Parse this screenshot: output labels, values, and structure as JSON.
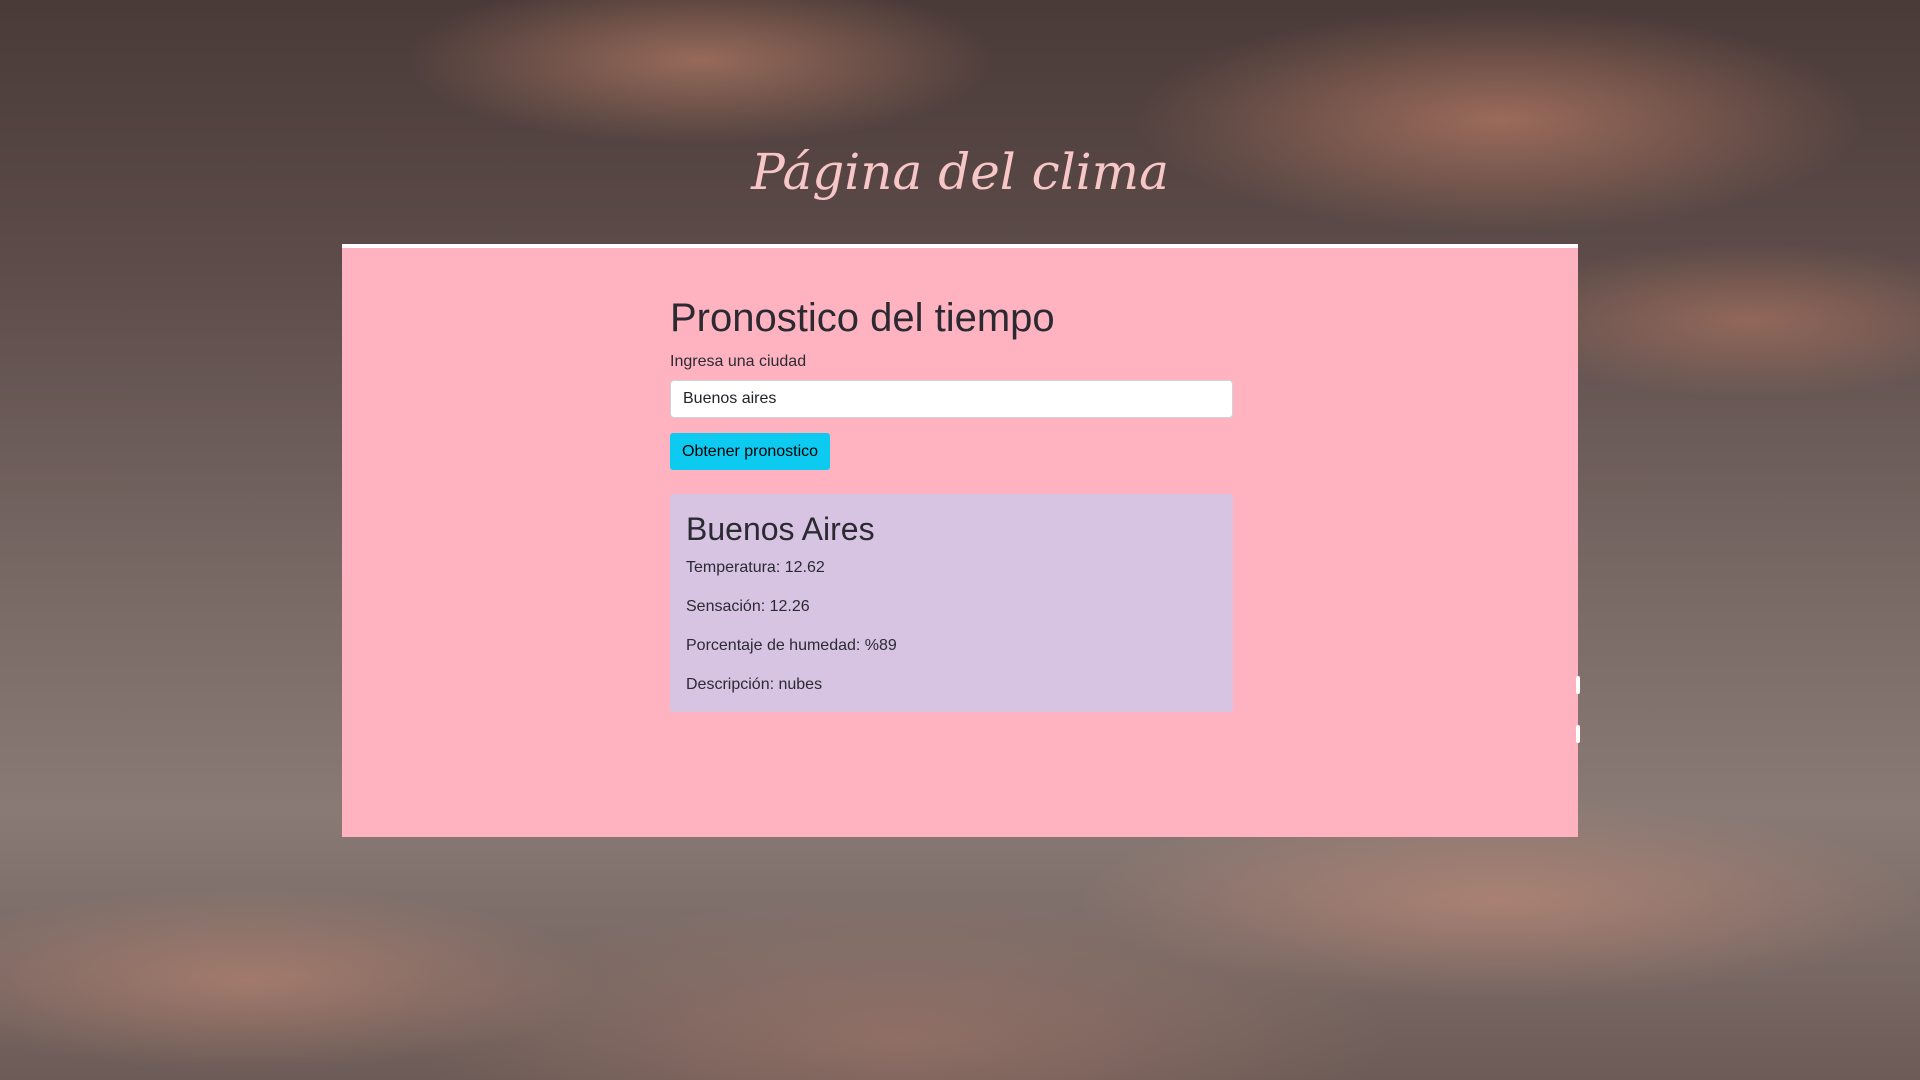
{
  "page": {
    "title": "Página del clima"
  },
  "form": {
    "heading": "Pronostico del tiempo",
    "label": "Ingresa una ciudad",
    "input_value": "Buenos aires",
    "button_label": "Obtener pronostico"
  },
  "result": {
    "city": "Buenos Aires",
    "temperature": "Temperatura: 12.62",
    "feels_like": "Sensación: 12.26",
    "humidity": "Porcentaje de humedad: %89",
    "description": "Descripción: nubes"
  },
  "colors": {
    "panel": "#ffb3c1",
    "card": "#d7c3e2",
    "button": "#0dcaf0",
    "title": "#f7c6c7"
  }
}
